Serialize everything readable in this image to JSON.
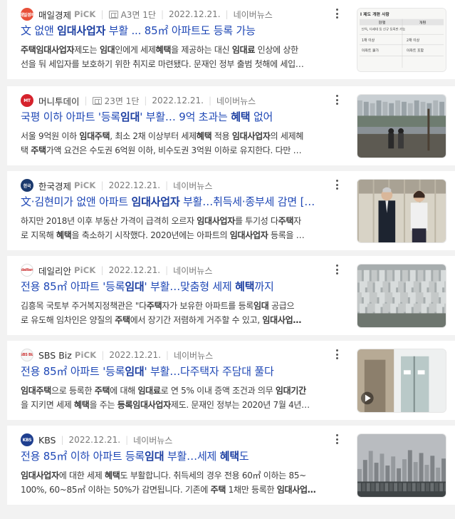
{
  "articles": [
    {
      "press": "매일경제",
      "pick": "PiCK",
      "paper": "A3면 1단",
      "date": "2022.12.21.",
      "source": "네이버뉴스",
      "logo_color": "#e8503a",
      "logo_text": "매일경제",
      "title": {
        "a": "文 없앤 ",
        "b": "임대사업자",
        "c": " 부활 ... 85㎡ 아파트도 등록 가능"
      },
      "desc_line1": "주택임대사업자제도는 임대인에게 세제혜택을 제공하는 대신 임대료 인상에 상한",
      "desc_line2": "선을 둬 세입자를 보호하기 위한 취지로 마련됐다. 문재인 정부 출범 첫해에 세입…",
      "thumb_kind": "table",
      "thumb_text": {
        "t1": "I 제도 개편 사항",
        "t2": "현행",
        "t3": "개편",
        "t4": "단독, 다세대 등 신규 등록만 가능",
        "t5": "1채 이상",
        "t6": "2채 이상",
        "t7": "아파트 불가",
        "t8": "아파트 포함"
      }
    },
    {
      "press": "머니투데이",
      "pick": "",
      "paper": "23면 1단",
      "date": "2022.12.21.",
      "source": "네이버뉴스",
      "logo_color": "#d6222c",
      "logo_text": "MT",
      "title": {
        "a": "국평 이하 아파트 '등록",
        "b": "임대",
        "c": "' 부활… 9억 초과는 ",
        "d": "혜택",
        "e": " 없어"
      },
      "desc_line1": "서울 9억원 이하 임대주택, 최소 2채 이상부터 세제혜택 적용 임대사업자의 세제혜",
      "desc_line2": "택 주택가액 요건은 수도권 6억원 이하, 비수도권 3억원 이하로 유지한다. 다만 …",
      "thumb_kind": "river"
    },
    {
      "press": "한국경제",
      "pick": "PiCK",
      "paper": "",
      "date": "2022.12.21.",
      "source": "네이버뉴스",
      "logo_color": "#1c3a6e",
      "logo_text": "한국",
      "title": {
        "a": "文·김현미가 없앤 아파트 ",
        "b": "임대사업자",
        "c": " 부활…취득세·종부세 감면 […"
      },
      "desc_line1": "하지만 2018년 이후 부동산 가격이 급격히 오르자 임대사업자를 투기성 다주택자",
      "desc_line2": "로 지목해 혜택을 축소하기 시작했다. 2020년에는 아파트의 임대사업자 등록을 …",
      "thumb_kind": "people"
    },
    {
      "press": "데일리안",
      "pick": "PiCK",
      "paper": "",
      "date": "2022.12.21.",
      "source": "네이버뉴스",
      "logo_color": "#ffffff",
      "logo_text": "dailian",
      "title": {
        "a": "전용 85㎡ 아파트 '등록",
        "b": "임대",
        "c": "' 부활…맞춤형 세제 ",
        "d": "혜택",
        "e": "까지"
      },
      "desc_line1": "김흥목 국토부 주거복지정책관은 \"다주택자가 보유한 아파트를 등록임대 공급으",
      "desc_line2": "로 유도해 임차인은 양질의 주택에서 장기간 저렴하게 거주할 수 있고, 임대사업…",
      "thumb_kind": "city"
    },
    {
      "press": "SBS Biz",
      "pick": "PiCK",
      "paper": "",
      "date": "2022.12.21.",
      "source": "네이버뉴스",
      "logo_color": "#f7f7f7",
      "logo_text": "SBS Biz",
      "title": {
        "a": "전용 85㎡ 아파트 '등록",
        "b": "임대",
        "c": "' 부활…다주택자 주담대 풀다"
      },
      "desc_line1": "임대주택으로 등록한 주택에 대해 임대료로 연 5% 이내 증액 조건과 의무 임대기간",
      "desc_line2": "을 지키면 세제 혜택을 주는 등록임대사업자제도. 문재인 정부는 2020년 7월 4년…",
      "thumb_kind": "office"
    },
    {
      "press": "KBS",
      "pick": "",
      "paper": "",
      "date": "2022.12.21.",
      "source": "네이버뉴스",
      "logo_color": "#1f3f8f",
      "logo_text": "KBS",
      "title": {
        "a": "전용 85㎡ 이하 아파트 등록",
        "b": "임대",
        "c": " 부활…세제 ",
        "d": "혜택",
        "e": "도"
      },
      "desc_line1": "임대사업자에 대한 세제 혜택도 부활합니다. 취득세의 경우 전용 60㎡ 이하는 85~",
      "desc_line2": "100%, 60~85㎡ 이하는 50%가 감면됩니다. 기존에 주택 1채만 등록한 임대사업…",
      "thumb_kind": "skyline"
    }
  ]
}
